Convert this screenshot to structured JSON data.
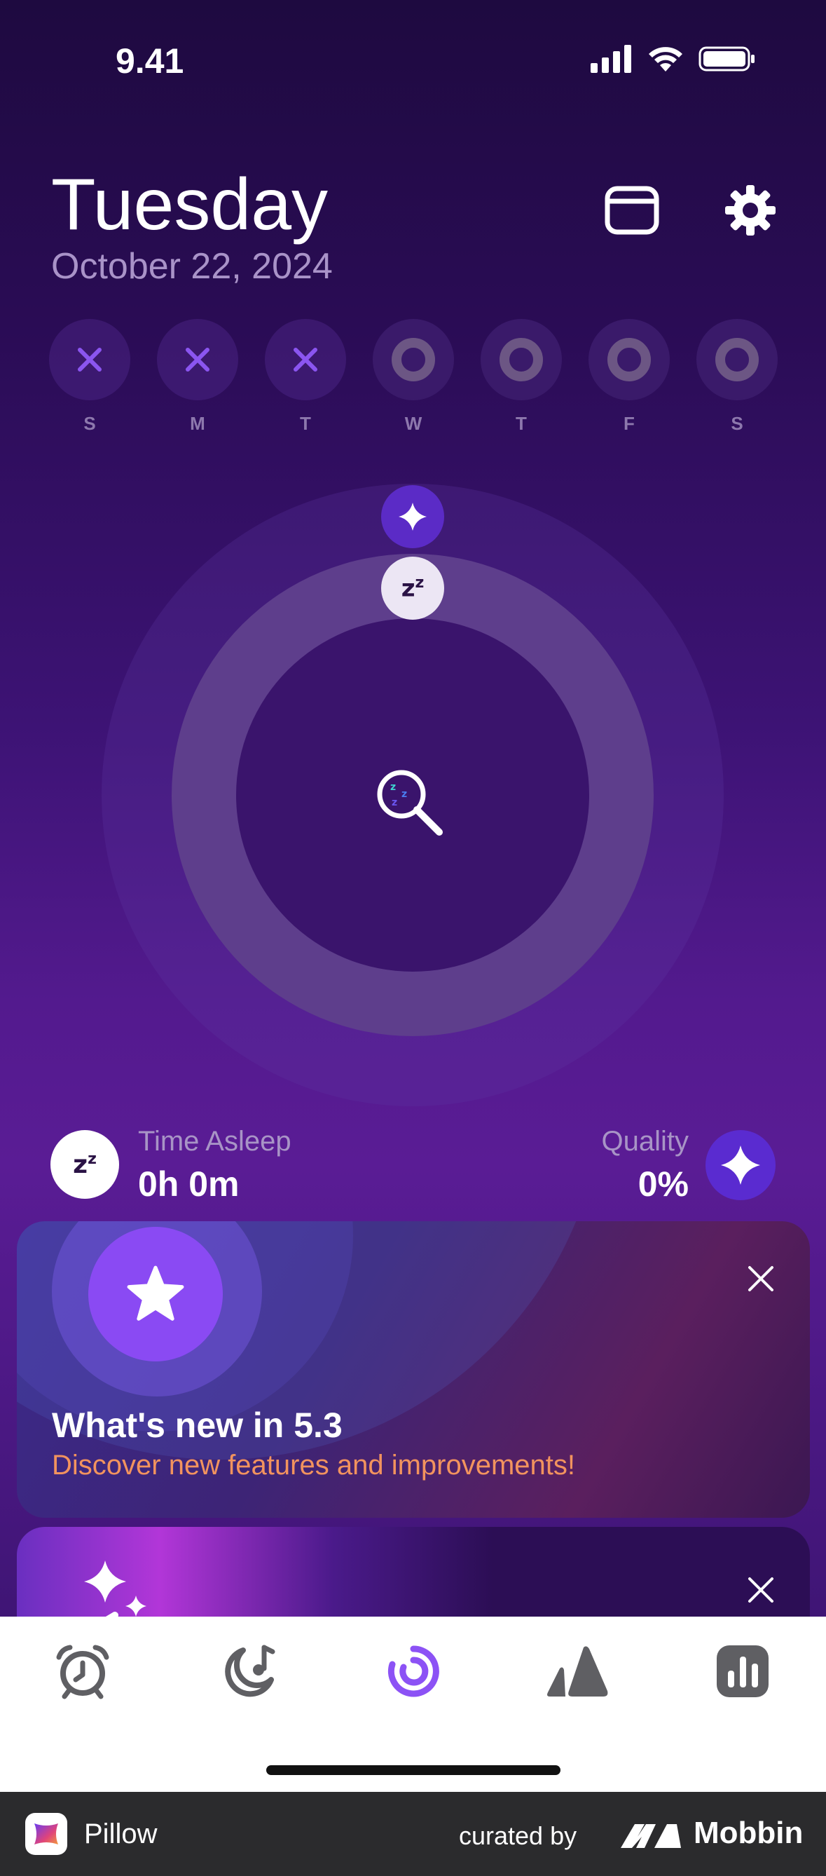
{
  "status_bar": {
    "time": "9.41"
  },
  "header": {
    "day": "Tuesday",
    "date": "October 22, 2024"
  },
  "week": [
    {
      "letter": "S",
      "state": "missed"
    },
    {
      "letter": "M",
      "state": "missed"
    },
    {
      "letter": "T",
      "state": "missed"
    },
    {
      "letter": "W",
      "state": "future"
    },
    {
      "letter": "T",
      "state": "future"
    },
    {
      "letter": "F",
      "state": "future"
    },
    {
      "letter": "S",
      "state": "future"
    }
  ],
  "stats": {
    "time_asleep_label": "Time Asleep",
    "time_asleep_value": "0h 0m",
    "quality_label": "Quality",
    "quality_value": "0%"
  },
  "cards": {
    "whats_new_title": "What's new in 5.3",
    "whats_new_subtitle": "Discover new features and improvements!"
  },
  "tabbar": {
    "items": [
      "alarm-tab",
      "sleep-tab",
      "analysis-tab",
      "trends-tab",
      "statistics-tab"
    ],
    "active": "analysis-tab"
  },
  "footer": {
    "app_name": "Pillow",
    "curated_by": "curated by",
    "brand": "Mobbin"
  },
  "colors": {
    "accent": "#8a4af3",
    "missed_x": "#8b55f0",
    "subtitle_orange": "#f2935e"
  }
}
